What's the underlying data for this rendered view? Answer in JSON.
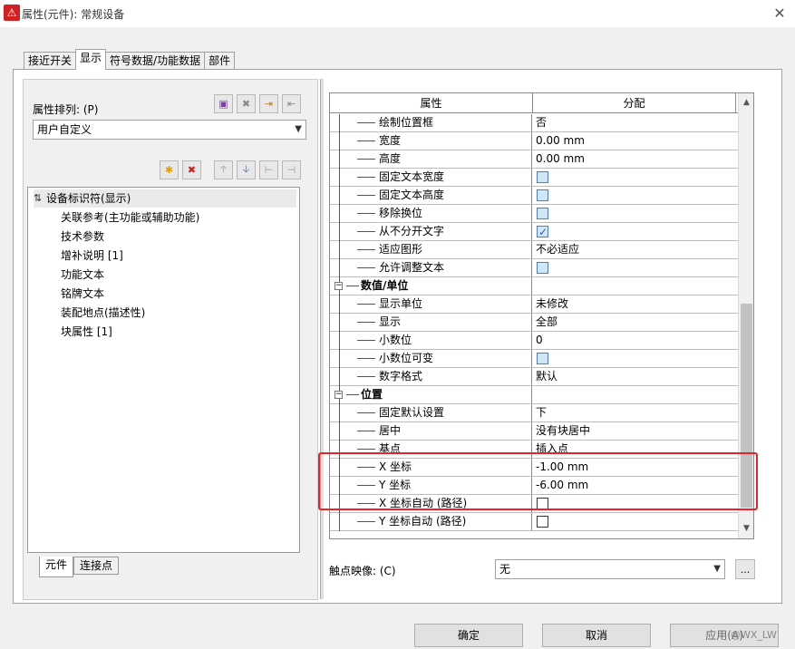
{
  "window": {
    "title": "属性(元件): 常规设备",
    "close_glyph": "✕",
    "app_glyph": "⚠"
  },
  "tabs": [
    {
      "label": "接近开关",
      "active": false
    },
    {
      "label": "显示",
      "active": true
    },
    {
      "label": "符号数据/功能数据",
      "active": false
    },
    {
      "label": "部件",
      "active": false
    }
  ],
  "left": {
    "sort_label": "属性排列: (P)",
    "sort_value": "用户自定义",
    "list_items": [
      "设备标识符(显示)",
      "关联参考(主功能或辅助功能)",
      "技术参数",
      "增补说明 [1]",
      "功能文本",
      "铭牌文本",
      "装配地点(描述性)",
      "块属性 [1]"
    ],
    "bottom_tabs": [
      "元件",
      "连接点"
    ]
  },
  "grid": {
    "col_property": "属性",
    "col_value": "分配",
    "rows": [
      {
        "type": "prop",
        "name": "绘制位置框",
        "value": "否"
      },
      {
        "type": "prop",
        "name": "宽度",
        "value": "0.00 mm"
      },
      {
        "type": "prop",
        "name": "高度",
        "value": "0.00 mm"
      },
      {
        "type": "check",
        "name": "固定文本宽度",
        "checked": false
      },
      {
        "type": "check",
        "name": "固定文本高度",
        "checked": false
      },
      {
        "type": "check",
        "name": "移除换位",
        "checked": false
      },
      {
        "type": "check",
        "name": "从不分开文字",
        "checked": true
      },
      {
        "type": "prop",
        "name": "适应图形",
        "value": "不必适应"
      },
      {
        "type": "check",
        "name": "允许调整文本",
        "checked": false
      },
      {
        "type": "cat",
        "name": "数值/单位"
      },
      {
        "type": "prop",
        "name": "显示单位",
        "value": "未修改"
      },
      {
        "type": "prop",
        "name": "显示",
        "value": "全部"
      },
      {
        "type": "prop",
        "name": "小数位",
        "value": "0"
      },
      {
        "type": "check",
        "name": "小数位可变",
        "checked": false
      },
      {
        "type": "prop",
        "name": "数字格式",
        "value": "默认"
      },
      {
        "type": "cat",
        "name": "位置"
      },
      {
        "type": "prop",
        "name": "固定默认设置",
        "value": "下"
      },
      {
        "type": "prop",
        "name": "居中",
        "value": "没有块居中"
      },
      {
        "type": "prop",
        "name": "基点",
        "value": "插入点"
      },
      {
        "type": "prop",
        "name": "X 坐标",
        "value": "-1.00 mm"
      },
      {
        "type": "prop",
        "name": "Y 坐标",
        "value": "-6.00 mm"
      },
      {
        "type": "check",
        "name": "X 坐标自动 (路径)",
        "checked": false,
        "plain": true
      },
      {
        "type": "check",
        "name": "Y 坐标自动 (路径)",
        "checked": false,
        "plain": true
      }
    ]
  },
  "contact_label": "触点映像: (C)",
  "contact_value": "无",
  "more_btn": "...",
  "buttons": {
    "ok": "确定",
    "cancel": "取消",
    "apply": "应用(A)"
  },
  "watermark": "@WX_LW"
}
